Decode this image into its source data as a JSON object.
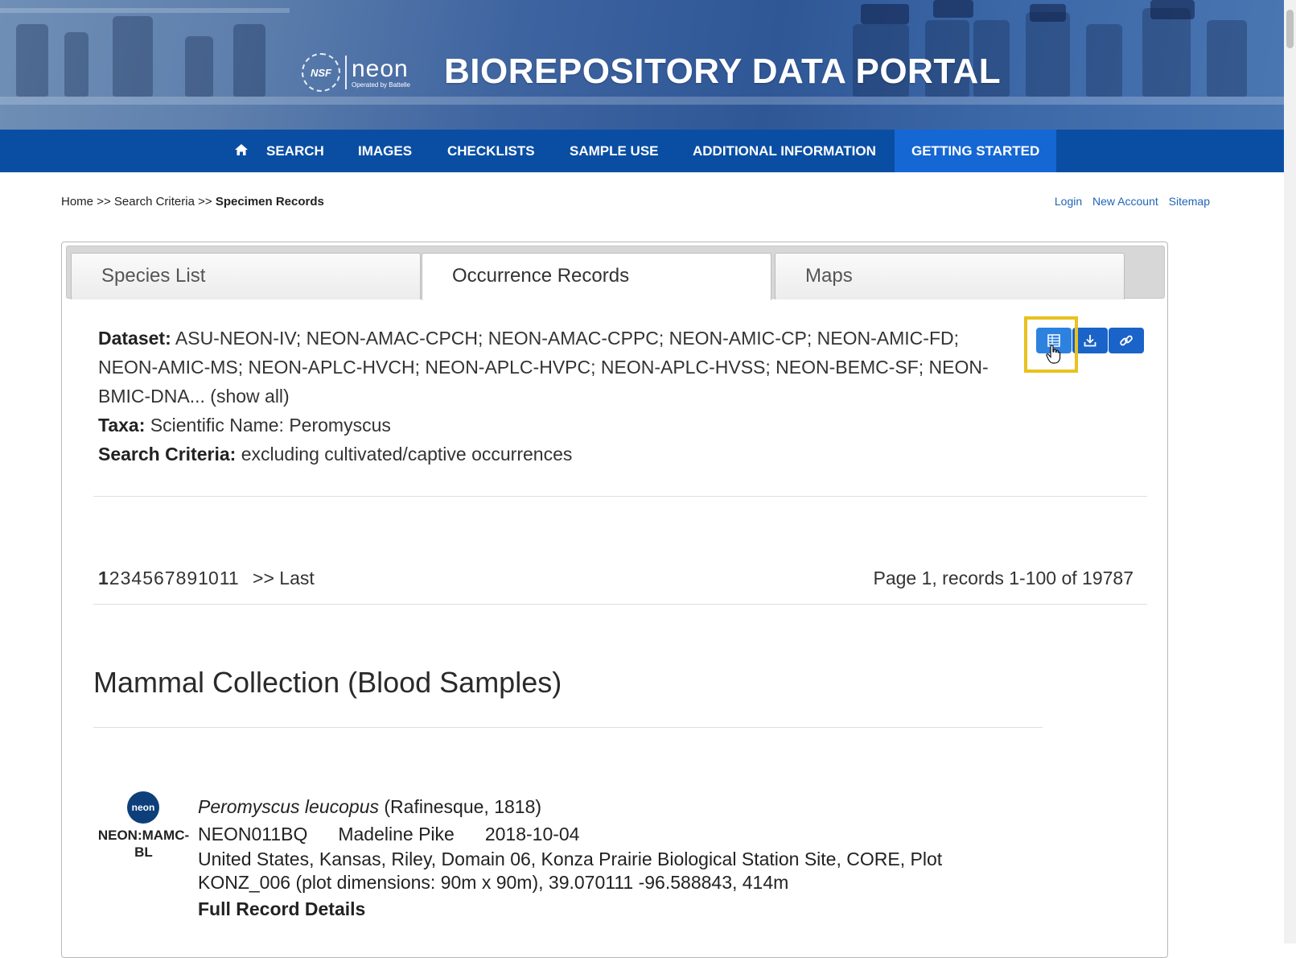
{
  "header": {
    "nsf_mark": "NSF",
    "neon_mark": "neon",
    "neon_sub": "Operated by Battelle",
    "title": "BIOREPOSITORY DATA PORTAL"
  },
  "nav": {
    "home_icon": "home-icon",
    "items": [
      "SEARCH",
      "IMAGES",
      "CHECKLISTS",
      "SAMPLE USE",
      "ADDITIONAL INFORMATION",
      "GETTING STARTED"
    ],
    "active": "GETTING STARTED"
  },
  "breadcrumb": {
    "home": "Home",
    "sep": ">>",
    "search": "Search Criteria",
    "current": "Specimen Records"
  },
  "top_links": [
    "Login",
    "New Account",
    "Sitemap"
  ],
  "tabs": [
    {
      "label": "Species List"
    },
    {
      "label": "Occurrence Records"
    },
    {
      "label": "Maps"
    }
  ],
  "active_tab": "Occurrence Records",
  "meta": {
    "dataset_label": "Dataset:",
    "dataset_value": "ASU-NEON-IV; NEON-AMAC-CPCH; NEON-AMAC-CPPC; NEON-AMIC-CP; NEON-AMIC-FD; NEON-AMIC-MS; NEON-APLC-HVCH; NEON-APLC-HVPC; NEON-APLC-HVSS; NEON-BEMC-SF; NEON-BMIC-DNA...",
    "show_all": "(show all)",
    "taxa_label": "Taxa:",
    "taxa_value": "Scientific Name: Peromyscus",
    "criteria_label": "Search Criteria:",
    "criteria_value": "excluding cultivated/captive occurrences"
  },
  "toolbar": {
    "buttons": [
      "table-icon",
      "download-icon",
      "link-icon"
    ],
    "accent": "#1a63c8",
    "highlight_color": "#e8c21e"
  },
  "pager": {
    "current": "1",
    "pages": [
      "2",
      "3",
      "4",
      "5",
      "6",
      "7",
      "8",
      "9",
      "10",
      "11"
    ],
    "last": ">> Last",
    "info": "Page 1, records 1-100 of 19787"
  },
  "collection": {
    "title": "Mammal Collection (Blood Samples)"
  },
  "record": {
    "logo_text": "neon",
    "catalog": "NEON:MAMC-BL",
    "scientific_name": "Peromyscus leucopus",
    "author": "(Rafinesque, 1818)",
    "catalog_number": "NEON011BQ",
    "collector": "Madeline Pike",
    "date": "2018-10-04",
    "locality": "United States, Kansas, Riley, Domain 06, Konza Prairie Biological Station Site, CORE, Plot KONZ_006 (plot dimensions: 90m x 90m), 39.070111 -96.588843, 414m",
    "details_link": "Full Record Details"
  }
}
